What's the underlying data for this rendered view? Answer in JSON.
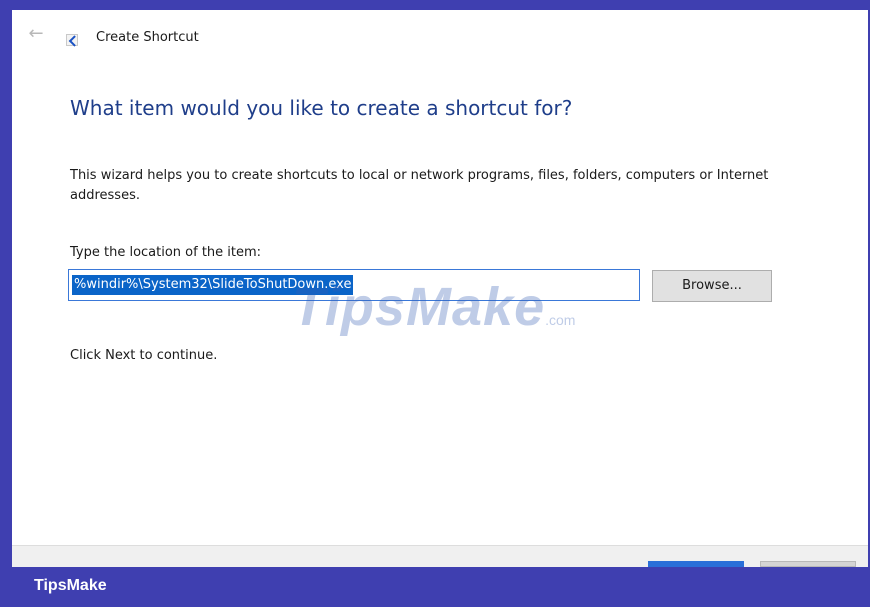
{
  "window": {
    "title": "Create Shortcut"
  },
  "icons": {
    "back": "back-arrow-icon",
    "app": "shortcut-icon"
  },
  "wizard": {
    "heading": "What item would you like to create a shortcut for?",
    "description": "This wizard helps you to create shortcuts to local or network programs, files, folders, computers or Internet addresses.",
    "location_label": "Type the location of the item:",
    "location_value": "%windir%\\System32\\SlideToShutDown.exe",
    "browse_label": "Browse...",
    "continue_text": "Click Next to continue."
  },
  "watermark": {
    "main": "TipsMake",
    "suffix": ".com"
  },
  "banner": {
    "text": "TipsMake"
  },
  "colors": {
    "heading": "#1f3e8a",
    "selection": "#0a64c8",
    "banner": "#3f3fb0",
    "input_border": "#3a78d8"
  }
}
